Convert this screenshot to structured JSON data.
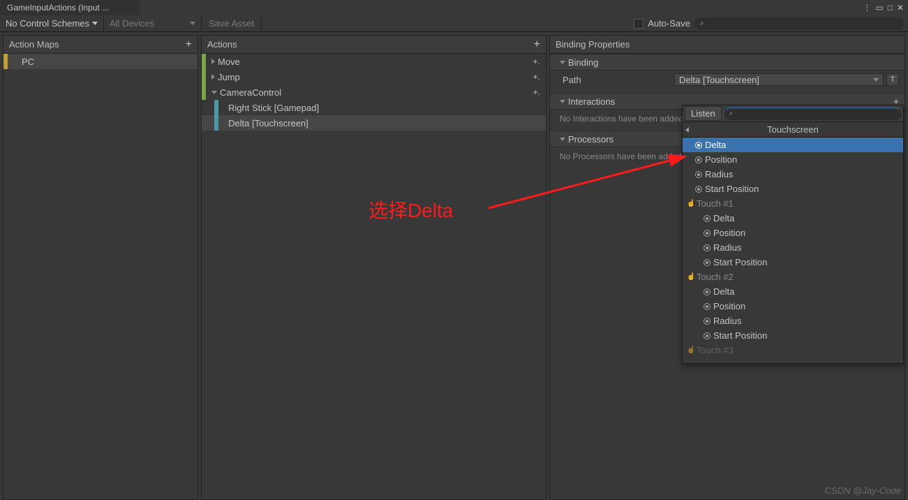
{
  "titlebar": {
    "tab": "GameInputActions (Input ..."
  },
  "toolbar": {
    "scheme": "No Control Schemes",
    "devices": "All Devices",
    "save": "Save Asset",
    "autosave": "Auto-Save"
  },
  "maps": {
    "title": "Action Maps",
    "items": [
      "PC"
    ]
  },
  "actions": {
    "title": "Actions",
    "items": [
      {
        "label": "Move",
        "expanded": false
      },
      {
        "label": "Jump",
        "expanded": false
      },
      {
        "label": "CameraControl",
        "expanded": true,
        "children": [
          {
            "label": "Right Stick [Gamepad]",
            "selected": false
          },
          {
            "label": "Delta [Touchscreen]",
            "selected": true
          }
        ]
      }
    ]
  },
  "props": {
    "title": "Binding Properties",
    "binding_section": "Binding",
    "path_label": "Path",
    "path_value": "Delta [Touchscreen]",
    "t_button": "T",
    "interactions_section": "Interactions",
    "interactions_empty": "No Interactions have been added.",
    "processors_section": "Processors",
    "processors_empty": "No Processors have been added."
  },
  "dropdown": {
    "listen": "Listen",
    "title": "Touchscreen",
    "items": [
      {
        "label": "Delta",
        "selected": true,
        "type": "radio"
      },
      {
        "label": "Position",
        "type": "radio"
      },
      {
        "label": "Radius",
        "type": "radio"
      },
      {
        "label": "Start Position",
        "type": "radio"
      },
      {
        "label": "Touch #1",
        "type": "group"
      },
      {
        "label": "Delta",
        "type": "radio",
        "indent": true
      },
      {
        "label": "Position",
        "type": "radio",
        "indent": true
      },
      {
        "label": "Radius",
        "type": "radio",
        "indent": true
      },
      {
        "label": "Start Position",
        "type": "radio",
        "indent": true
      },
      {
        "label": "Touch #2",
        "type": "group"
      },
      {
        "label": "Delta",
        "type": "radio",
        "indent": true
      },
      {
        "label": "Position",
        "type": "radio",
        "indent": true
      },
      {
        "label": "Radius",
        "type": "radio",
        "indent": true
      },
      {
        "label": "Start Position",
        "type": "radio",
        "indent": true
      },
      {
        "label": "Touch #3",
        "type": "group",
        "fade": true
      }
    ]
  },
  "annotation": {
    "text": "选择Delta"
  },
  "watermark": "CSDN @Jay-Code"
}
